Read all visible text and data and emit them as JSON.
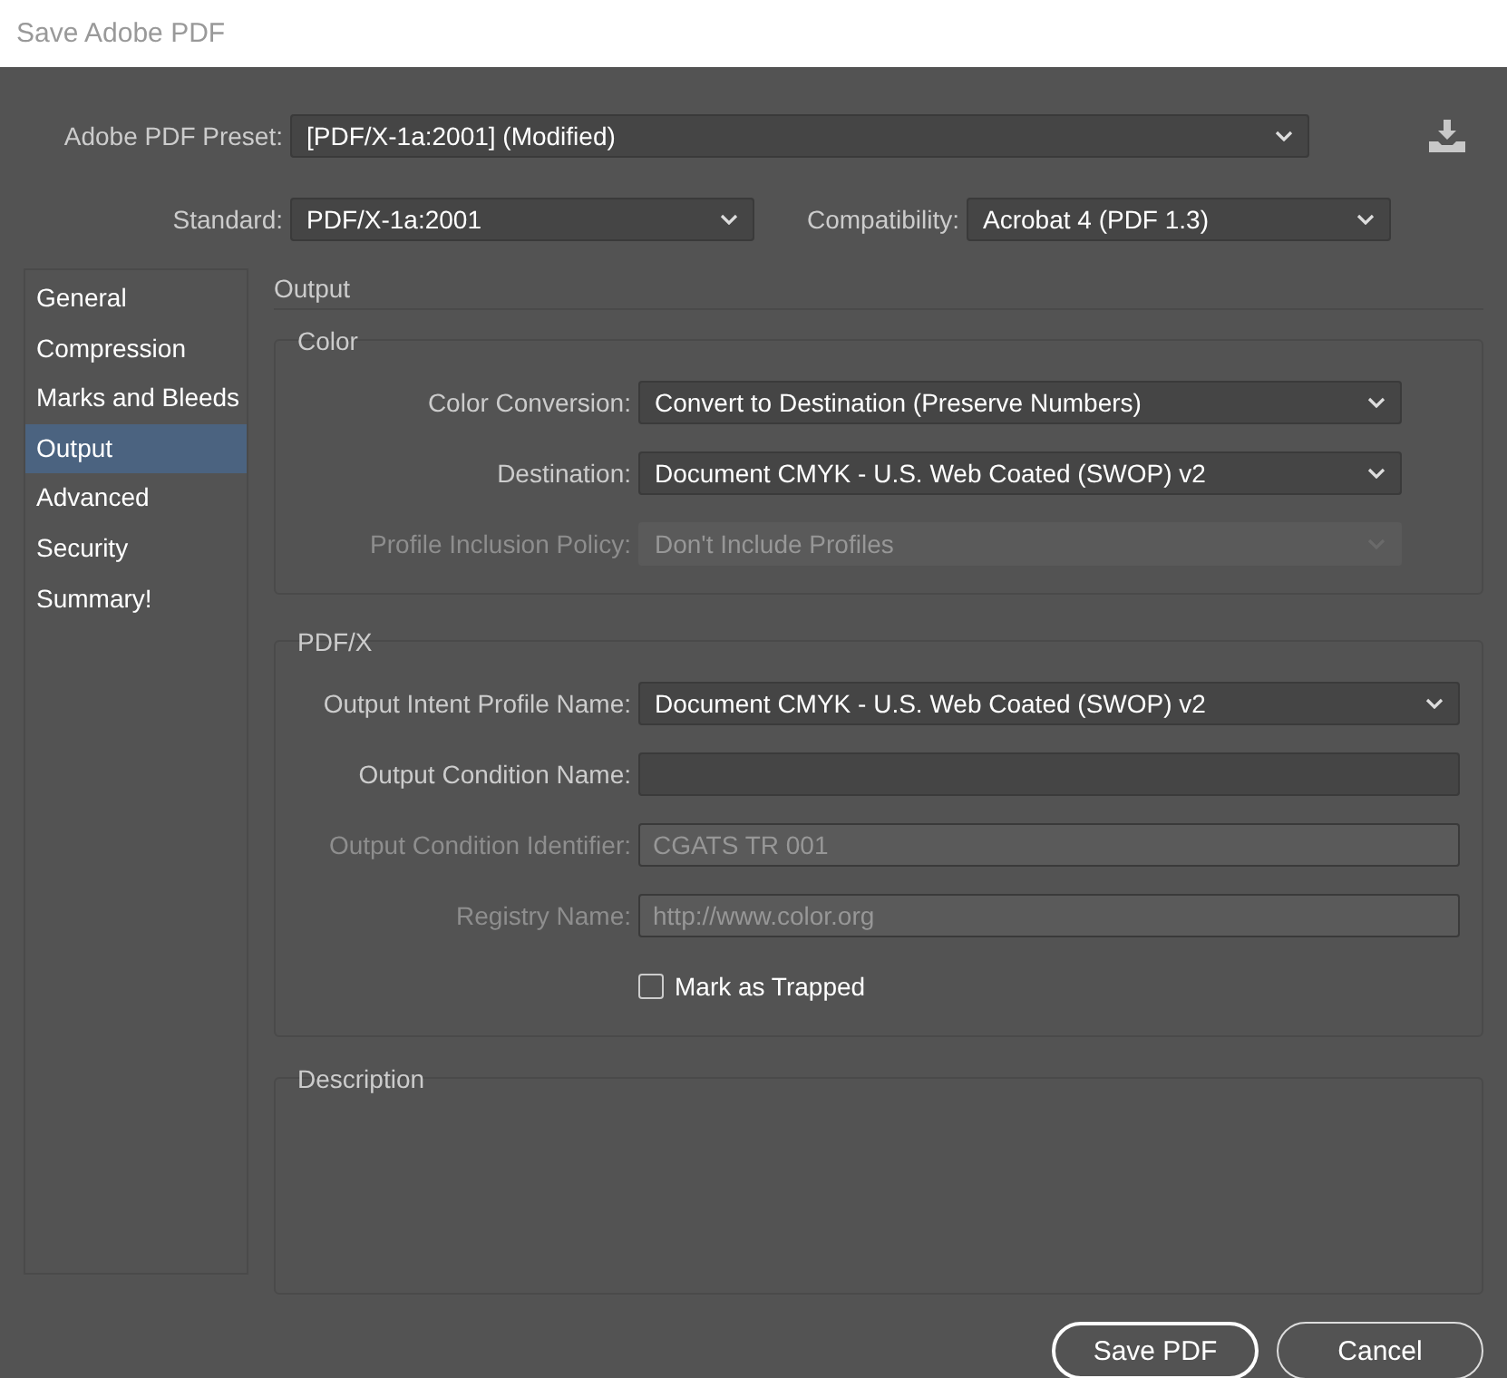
{
  "window": {
    "title": "Save Adobe PDF"
  },
  "preset": {
    "label": "Adobe PDF Preset:",
    "value": "[PDF/X-1a:2001] (Modified)"
  },
  "standard": {
    "label": "Standard:",
    "value": "PDF/X-1a:2001"
  },
  "compatibility": {
    "label": "Compatibility:",
    "value": "Acrobat 4 (PDF 1.3)"
  },
  "sidebar": {
    "items": [
      {
        "label": "General",
        "selected": false
      },
      {
        "label": "Compression",
        "selected": false
      },
      {
        "label": "Marks and Bleeds",
        "selected": false
      },
      {
        "label": "Output",
        "selected": true
      },
      {
        "label": "Advanced",
        "selected": false
      },
      {
        "label": "Security",
        "selected": false
      },
      {
        "label": "Summary!",
        "selected": false
      }
    ]
  },
  "section_title": "Output",
  "groups": [
    {
      "title": "Color",
      "fields": [
        {
          "kind": "dropdown",
          "label": "Color Conversion:",
          "value": "Convert to Destination (Preserve Numbers)",
          "disabled": false
        },
        {
          "kind": "dropdown",
          "label": "Destination:",
          "value": "Document CMYK - U.S. Web Coated (SWOP) v2",
          "disabled": false
        },
        {
          "kind": "dropdown",
          "label": "Profile Inclusion Policy:",
          "value": "Don't Include Profiles",
          "disabled": true
        }
      ]
    },
    {
      "title": "PDF/X",
      "fields": [
        {
          "kind": "dropdown",
          "label": "Output Intent Profile Name:",
          "value": "Document CMYK - U.S. Web Coated (SWOP) v2",
          "disabled": false
        },
        {
          "kind": "text",
          "label": "Output Condition Name:",
          "disabled": false
        },
        {
          "kind": "text",
          "label": "Output Condition Identifier:",
          "value": "CGATS TR 001",
          "disabled": true
        },
        {
          "kind": "text",
          "label": "Registry Name:",
          "value": "http://www.color.org",
          "disabled": true
        },
        {
          "kind": "checkbox",
          "label": "Mark as Trapped",
          "checked": false,
          "disabled": false
        }
      ]
    }
  ],
  "description": {
    "title": "Description"
  },
  "buttons": [
    {
      "label": "Save PDF",
      "kind": "default"
    },
    {
      "label": "Cancel",
      "kind": "normal"
    }
  ]
}
